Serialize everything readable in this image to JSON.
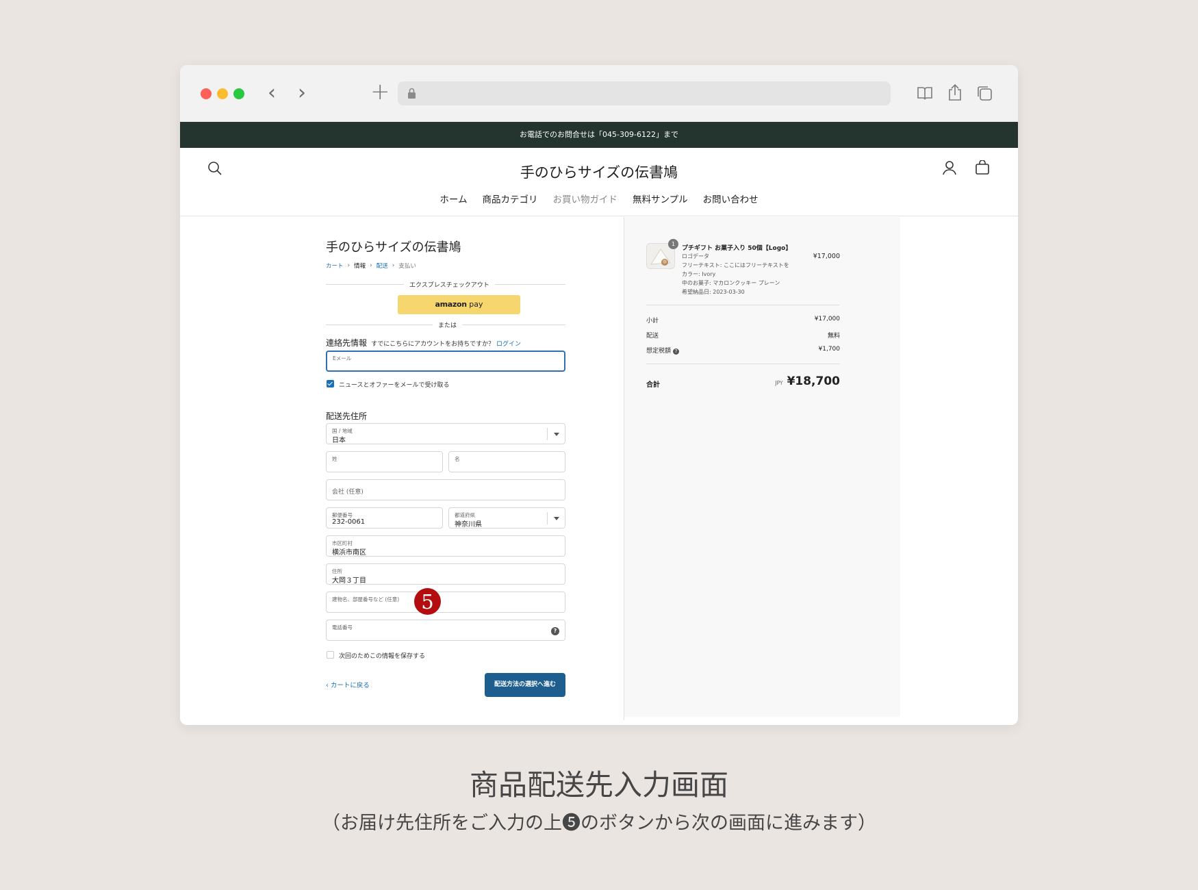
{
  "announcement": "お電話でのお問合せは「045-309-6122」まで",
  "store": {
    "logo": "手のひらサイズの伝書鳩",
    "nav": [
      "ホーム",
      "商品カテゴリ",
      "お買い物ガイド",
      "無料サンプル",
      "お問い合わせ"
    ]
  },
  "checkout": {
    "title": "手のひらサイズの伝書鳩",
    "breadcrumbs": [
      "カート",
      "情報",
      "配送",
      "支払い"
    ],
    "express_label": "エクスプレスチェックアウト",
    "amazon_pay": {
      "brand": "amazon",
      "suffix": " pay"
    },
    "or_label": "または",
    "contact": {
      "title": "連絡先情報",
      "login_question": "すでにこちらにアカウントをお持ちですか？",
      "login_link": "ログイン",
      "email_placeholder": "Eメール",
      "newsletter_label": "ニュースとオファーをメールで受け取る"
    },
    "shipping": {
      "title": "配送先住所",
      "country_label": "国 / 地域",
      "country_value": "日本",
      "last_name_label": "姓",
      "first_name_label": "名",
      "company_placeholder": "会社 (任意)",
      "postal_label": "郵便番号",
      "postal_value": "232-0061",
      "prefecture_label": "都道府県",
      "prefecture_value": "神奈川県",
      "city_label": "市区町村",
      "city_value": "横浜市南区",
      "address_label": "住所",
      "address_value": "大岡３丁目",
      "building_placeholder": "建物名、部屋番号など (任意)",
      "phone_placeholder": "電話番号",
      "save_info_label": "次回のためこの情報を保存する"
    },
    "back_label": "カートに戻る",
    "continue_label": "配送方法の選択へ進む",
    "step_badge": "5"
  },
  "summary": {
    "item": {
      "qty": "1",
      "name": "プチギフト お菓子入り 50個【Logo】",
      "variants": [
        "ロゴデータ",
        "フリーテキスト: ここにはフリーテキストを",
        "カラー: Ivory",
        "中のお菓子: マカロンクッキー プレーン",
        "希望納品日: 2023-03-30"
      ],
      "price": "¥17,000"
    },
    "subtotal_label": "小計",
    "subtotal_value": "¥17,000",
    "shipping_label": "配送",
    "shipping_value": "無料",
    "tax_label": "想定税額",
    "tax_value": "¥1,700",
    "total_label": "合計",
    "currency": "JPY",
    "total_value": "¥18,700"
  },
  "caption": {
    "title": "商品配送先入力画面",
    "subtitle": "（お届け先住所をご入力の上❺のボタンから次の画面に進みます）"
  }
}
